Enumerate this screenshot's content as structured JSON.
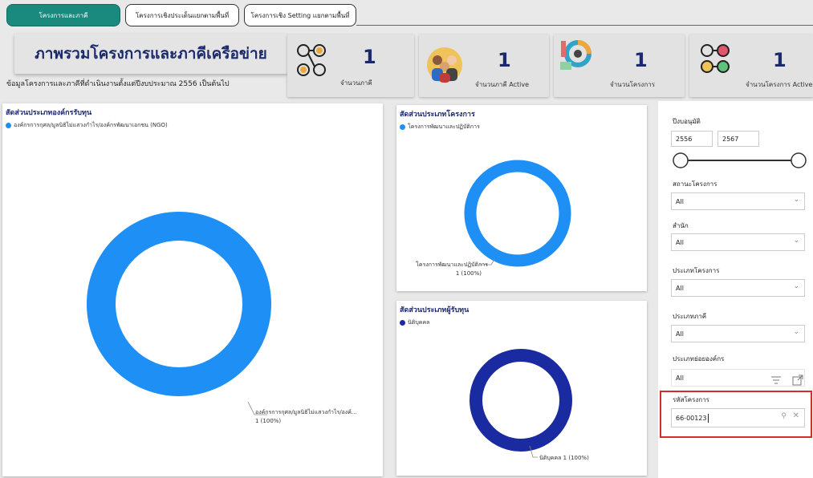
{
  "tabs": [
    {
      "label": "โครงการและภาคี",
      "active": true
    },
    {
      "label": "โครงการเชิงประเด็นแยกตามพื้นที่",
      "active": false
    },
    {
      "label": "โครงการเชิง Setting แยกตามพื้นที่",
      "active": false
    }
  ],
  "header": {
    "title": "ภาพรวมโครงการและภาคีเครือข่าย",
    "subtitle": "ข้อมูลโครงการและภาคีที่ดำเนินงานตั้งแต่ปีงบประมาณ 2556 เป็นต้นไป"
  },
  "kpis": [
    {
      "value": "1",
      "label": "จำนวนภาคี",
      "icon": "network-people-icon"
    },
    {
      "value": "1",
      "label": "จำนวนภาคี Active",
      "icon": "team-people-icon"
    },
    {
      "value": "1",
      "label": "จำนวนโครงการ",
      "icon": "project-dashboard-icon"
    },
    {
      "value": "1",
      "label": "จำนวนโครงการ Active",
      "icon": "project-exchange-icon"
    }
  ],
  "chart_data": [
    {
      "type": "pie",
      "title": "สัดส่วนประเภทองค์กรรับทุน",
      "categories": [
        "องค์กรการกุศล/มูลนิธิไม่แสวงกำไร/องค์กรพัฒนาเอกชน (NGO)"
      ],
      "values": [
        1
      ],
      "data_label_line1": "องค์กรการกุศล/มูลนิธิไม่แสวงกำไร/องค์...",
      "data_label_line2": "1 (100%)",
      "colors": [
        "#1e90f5"
      ]
    },
    {
      "type": "pie",
      "title": "สัดส่วนประเภทโครงการ",
      "categories": [
        "โครงการพัฒนาและปฏิบัติการ"
      ],
      "values": [
        1
      ],
      "data_label_line1": "โครงการพัฒนาและปฏิบัติการ",
      "data_label_line2": "1 (100%)",
      "colors": [
        "#1e90f5"
      ]
    },
    {
      "type": "pie",
      "title": "สัดส่วนประเภทผู้รับทุน",
      "categories": [
        "นิติบุคคล"
      ],
      "values": [
        1
      ],
      "data_label_line1": "นิติบุคคล 1 (100%)",
      "data_label_line2": "",
      "colors": [
        "#1a2aa0"
      ]
    }
  ],
  "filters": {
    "year_label": "ปีงบอนุมัติ",
    "year_from": "2556",
    "year_to": "2567",
    "status_label": "สถานะโครงการ",
    "status_value": "All",
    "office_label": "สำนัก",
    "office_value": "All",
    "ptype_label": "ประเภทโครงการ",
    "ptype_value": "All",
    "partner_label": "ประเภทภาคี",
    "partner_value": "All",
    "subtype_label": "ประเภทย่อยองค์กร",
    "subtype_value": "All",
    "code_label": "รหัสโครงการ",
    "code_value": "66-00123"
  },
  "colors": {
    "accent": "#1a8a7f",
    "title": "#1b2a6b",
    "donut_light": "#1e90f5",
    "donut_dark": "#1a2aa0",
    "highlight": "#d62b2b"
  }
}
